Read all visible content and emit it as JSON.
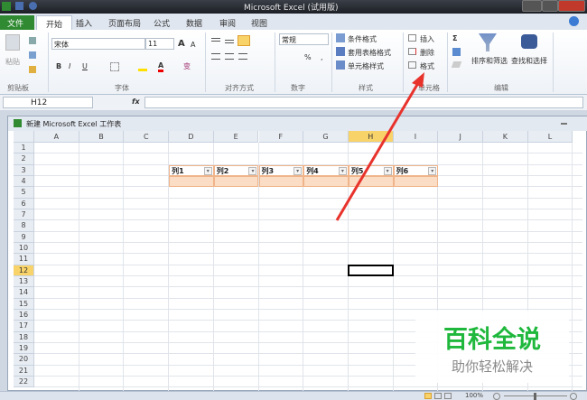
{
  "window": {
    "title": "Microsoft Excel (试用版)"
  },
  "tabs": [
    {
      "label": "文件"
    },
    {
      "label": "开始"
    },
    {
      "label": "插入"
    },
    {
      "label": "页面布局"
    },
    {
      "label": "公式"
    },
    {
      "label": "数据"
    },
    {
      "label": "审阅"
    },
    {
      "label": "视图"
    }
  ],
  "ribbon": {
    "clipboard": {
      "paste": "粘贴",
      "label": "剪贴板"
    },
    "font": {
      "name": "宋体",
      "size": "11",
      "bold": "B",
      "italic": "I",
      "underline": "U",
      "label": "字体",
      "grow": "A",
      "shrink": "A",
      "wen": "变"
    },
    "alignment": {
      "label": "对齐方式"
    },
    "number": {
      "format": "常规",
      "percent": "%",
      "comma": ",",
      "label": "数字"
    },
    "styles": {
      "items": [
        "条件格式",
        "套用表格格式",
        "单元格样式"
      ],
      "label": "样式"
    },
    "cells": {
      "items": [
        "插入",
        "删除",
        "格式"
      ],
      "label": "单元格"
    },
    "editing": {
      "sigma": "Σ",
      "sort": "排序和筛选",
      "find": "查找和选择",
      "label": "编辑"
    }
  },
  "formula_bar": {
    "name_box": "H12",
    "fx": "fx",
    "value": ""
  },
  "workbook": {
    "title": "新建 Microsoft Excel 工作表"
  },
  "columns": [
    "A",
    "B",
    "C",
    "D",
    "E",
    "F",
    "G",
    "H",
    "I",
    "J",
    "K",
    "L"
  ],
  "rows": [
    "1",
    "2",
    "3",
    "4",
    "5",
    "6",
    "7",
    "8",
    "9",
    "10",
    "11",
    "12",
    "13",
    "14",
    "15",
    "16",
    "17",
    "18",
    "19",
    "20",
    "21",
    "22"
  ],
  "selected": {
    "column": "H",
    "row": "12"
  },
  "table_headers": [
    "列1",
    "列2",
    "列3",
    "列4",
    "列5",
    "列6"
  ],
  "watermark": {
    "title": "百科全说",
    "subtitle": "助你轻松解决"
  },
  "status": {
    "zoom": "100%"
  },
  "colors": {
    "file_tab": "#2f8a32",
    "table_border": "#f0b48a",
    "table_row": "#fbdcc4",
    "arrow": "#e8322c",
    "watermark": "#1fb83c",
    "selection": "#f8d36a"
  }
}
